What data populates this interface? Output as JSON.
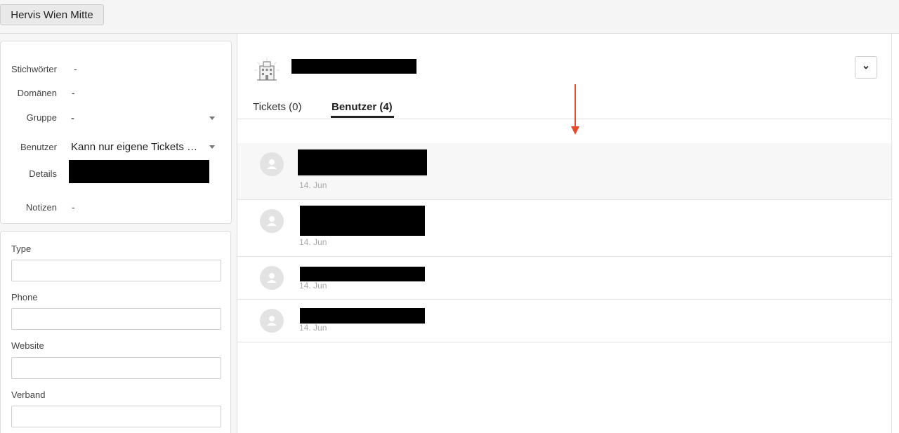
{
  "topbar": {
    "tab_label": "Hervis Wien Mitte"
  },
  "attributes": {
    "stichwoerter": {
      "label": "Stichwörter",
      "value": "-"
    },
    "domaenen": {
      "label": "Domänen",
      "value": "-"
    },
    "gruppe": {
      "label": "Gruppe",
      "value": "-"
    },
    "benutzer": {
      "label": "Benutzer",
      "value": "Kann nur eigene Tickets sehen"
    },
    "details": {
      "label": "Details"
    },
    "notizen": {
      "label": "Notizen",
      "value": "-"
    }
  },
  "fields": {
    "type": {
      "label": "Type",
      "value": ""
    },
    "phone": {
      "label": "Phone",
      "value": ""
    },
    "website": {
      "label": "Website",
      "value": ""
    },
    "verband": {
      "label": "Verband",
      "value": ""
    }
  },
  "main": {
    "tabs": [
      {
        "label": "Tickets (0)"
      },
      {
        "label": "Benutzer (4)"
      }
    ],
    "users": [
      {
        "date": "14. Jun"
      },
      {
        "date": "14. Jun"
      },
      {
        "date": "14. Jun"
      },
      {
        "date": "14. Jun"
      }
    ]
  },
  "colors": {
    "annotation_arrow": "#e34b2b"
  }
}
